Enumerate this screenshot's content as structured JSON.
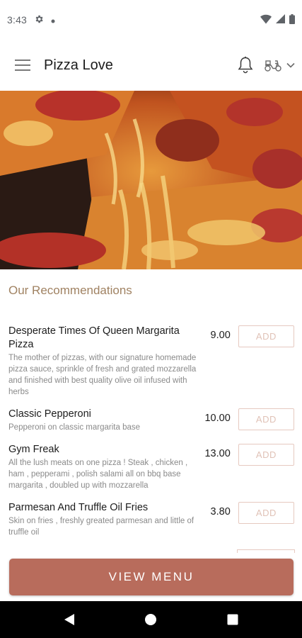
{
  "status_bar": {
    "time": "3:43",
    "icons": [
      "gear-icon",
      "dot-icon",
      "wifi-icon",
      "signal-icon",
      "battery-icon"
    ]
  },
  "app_bar": {
    "title": "Pizza Love",
    "icons": [
      "hamburger-menu-icon",
      "bell-icon",
      "scooter-icon",
      "chevron-down-icon"
    ]
  },
  "hero": {
    "image": "pizza-photo"
  },
  "section": {
    "title": "Our Recommendations"
  },
  "menu_items": [
    {
      "name": "Desperate Times Of Queen Margarita Pizza",
      "description": "The mother of pizzas, with our signature homemade pizza sauce, sprinkle of fresh and grated mozzarella and finished with best quality olive oil infused with herbs",
      "price": "9.00",
      "add_label": "ADD"
    },
    {
      "name": "Classic Pepperoni",
      "description": "Pepperoni on classic margarita base",
      "price": "10.00",
      "add_label": "ADD"
    },
    {
      "name": "Gym Freak",
      "description": "All the lush meats on one pizza ! Steak , chicken , ham , pepperami , polish salami all on bbq base margarita , doubled up with mozzarella",
      "price": "13.00",
      "add_label": "ADD"
    },
    {
      "name": "Parmesan And Truffle Oil Fries",
      "description": "Skin on fries , freshly greated parmesan and little of truffle oil",
      "price": "3.80",
      "add_label": "ADD"
    }
  ],
  "cta": {
    "label": "VIEW MENU"
  },
  "colors": {
    "accent": "#b86c5c",
    "section_title": "#a08262",
    "add_border": "#e6c9c0"
  },
  "nav_bar": {
    "icons": [
      "back-icon",
      "home-icon",
      "recents-icon"
    ]
  }
}
